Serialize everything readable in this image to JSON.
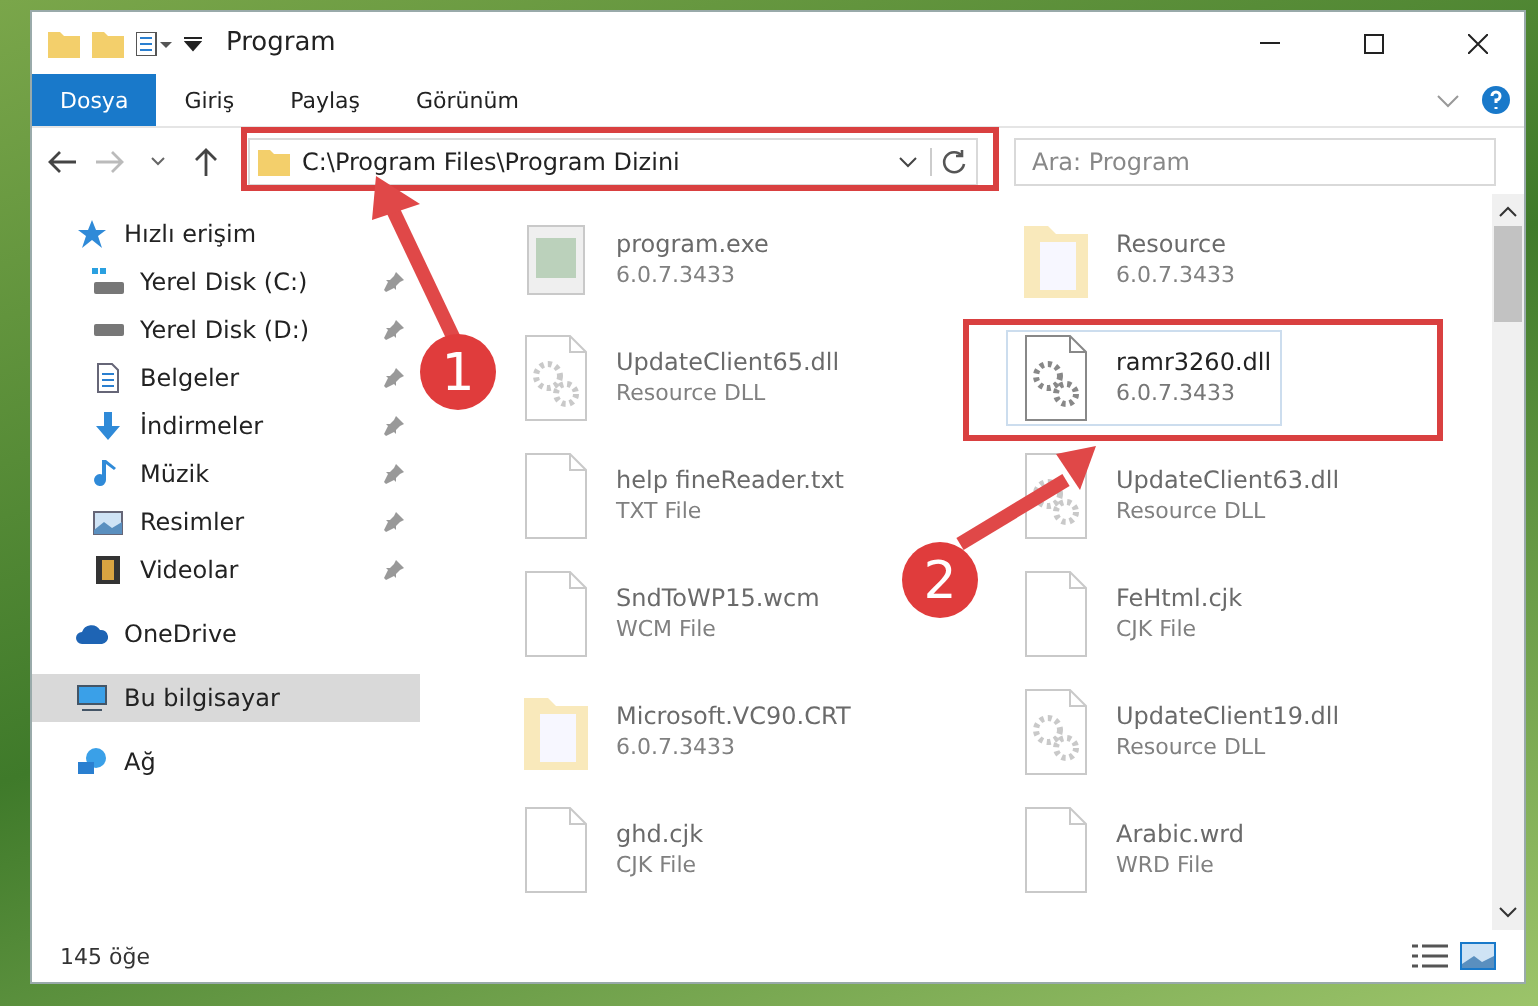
{
  "window": {
    "title": "Program"
  },
  "ribbon_tabs": [
    {
      "label": "Dosya",
      "selected": true
    },
    {
      "label": "Giriş",
      "selected": false
    },
    {
      "label": "Paylaş",
      "selected": false
    },
    {
      "label": "Görünüm",
      "selected": false
    }
  ],
  "address": {
    "path": "C:\\Program Files\\Program Dizini"
  },
  "search": {
    "placeholder": "Ara: Program"
  },
  "sidebar": {
    "items": [
      {
        "label": "Hızlı erişim",
        "kind": "star",
        "selected": false,
        "pinned": false,
        "children": [
          {
            "label": "Yerel Disk (C:)",
            "kind": "disk-c",
            "selected": false,
            "pinned": true
          },
          {
            "label": "Yerel Disk (D:)",
            "kind": "disk",
            "selected": false,
            "pinned": true
          },
          {
            "label": "Belgeler",
            "kind": "docs",
            "selected": false,
            "pinned": true
          },
          {
            "label": "İndirmeler",
            "kind": "download",
            "selected": false,
            "pinned": true
          },
          {
            "label": "Müzik",
            "kind": "music",
            "selected": false,
            "pinned": true
          },
          {
            "label": "Resimler",
            "kind": "pictures",
            "selected": false,
            "pinned": true
          },
          {
            "label": "Videolar",
            "kind": "video",
            "selected": false,
            "pinned": true
          }
        ]
      },
      {
        "label": "OneDrive",
        "kind": "cloud",
        "selected": false,
        "pinned": false
      },
      {
        "label": "Bu bilgisayar",
        "kind": "pc",
        "selected": true,
        "pinned": false
      },
      {
        "label": "Ağ",
        "kind": "network",
        "selected": false,
        "pinned": false
      }
    ]
  },
  "files": [
    {
      "name": "program.exe",
      "detail": "6.0.7.3433",
      "kind": "exe",
      "focused": false
    },
    {
      "name": "Resource",
      "detail": "6.0.7.3433",
      "kind": "folder",
      "focused": false
    },
    {
      "name": "UpdateClient65.dll",
      "detail": "Resource DLL",
      "kind": "dll",
      "focused": false
    },
    {
      "name": "ramr3260.dll",
      "detail": "6.0.7.3433",
      "kind": "dll",
      "focused": true
    },
    {
      "name": "help fineReader.txt",
      "detail": "TXT File",
      "kind": "file",
      "focused": false
    },
    {
      "name": "UpdateClient63.dll",
      "detail": "Resource DLL",
      "kind": "dll",
      "focused": false
    },
    {
      "name": "SndToWP15.wcm",
      "detail": "WCM File",
      "kind": "file",
      "focused": false
    },
    {
      "name": "FeHtml.cjk",
      "detail": "CJK File",
      "kind": "file",
      "focused": false
    },
    {
      "name": "Microsoft.VC90.CRT",
      "detail": "6.0.7.3433",
      "kind": "folder",
      "focused": false
    },
    {
      "name": "UpdateClient19.dll",
      "detail": "Resource DLL",
      "kind": "dll",
      "focused": false
    },
    {
      "name": "ghd.cjk",
      "detail": "CJK File",
      "kind": "file",
      "focused": false
    },
    {
      "name": "Arabic.wrd",
      "detail": "WRD File",
      "kind": "file",
      "focused": false
    }
  ],
  "status_bar": {
    "count": "145 öğe"
  },
  "callouts": [
    {
      "label": "1"
    },
    {
      "label": "2"
    }
  ]
}
